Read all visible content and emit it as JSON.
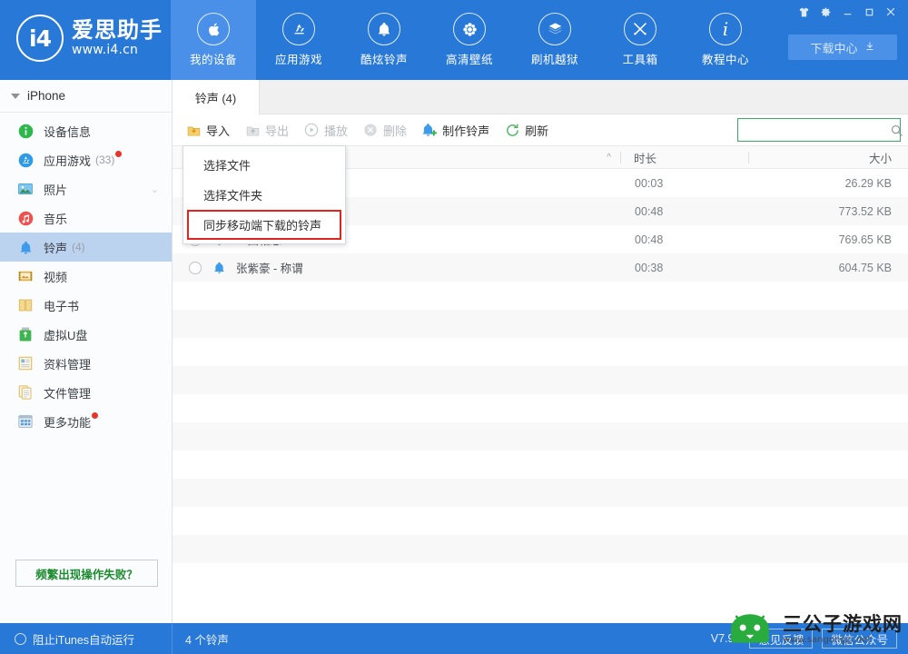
{
  "app": {
    "brand_name": "爱思助手",
    "brand_url": "www.i4.cn",
    "logo_mark": "i4",
    "accent_color": "#2878d8",
    "accent_active": "#4a90e8",
    "version": "V7.93"
  },
  "nav": [
    {
      "label": "我的设备",
      "icon": "apple-icon",
      "active": true
    },
    {
      "label": "应用游戏",
      "icon": "appstore-icon",
      "active": false
    },
    {
      "label": "酷炫铃声",
      "icon": "bell-icon",
      "active": false
    },
    {
      "label": "高清壁纸",
      "icon": "flower-icon",
      "active": false
    },
    {
      "label": "刷机越狱",
      "icon": "flash-box-icon",
      "active": false
    },
    {
      "label": "工具箱",
      "icon": "tools-icon",
      "active": false
    },
    {
      "label": "教程中心",
      "icon": "info-icon",
      "active": false
    }
  ],
  "window_controls": [
    {
      "name": "skin-icon",
      "glyph": "skin"
    },
    {
      "name": "settings-gear-icon",
      "glyph": "gear"
    },
    {
      "name": "minimize-icon",
      "glyph": "minimize"
    },
    {
      "name": "maximize-icon",
      "glyph": "maximize"
    },
    {
      "name": "close-icon",
      "glyph": "close"
    }
  ],
  "download_center": {
    "label": "下载中心",
    "icon": "download-icon"
  },
  "sidebar": {
    "device": {
      "name": "iPhone",
      "expanded": true
    },
    "items": [
      {
        "label": "设备信息",
        "icon": "info-circle-icon",
        "count": "",
        "badge": false,
        "active": false,
        "chevron": false
      },
      {
        "label": "应用游戏",
        "icon": "appstore-circle-icon",
        "count": "(33)",
        "badge": true,
        "active": false,
        "chevron": false
      },
      {
        "label": "照片",
        "icon": "photo-icon",
        "count": "",
        "badge": false,
        "active": false,
        "chevron": true
      },
      {
        "label": "音乐",
        "icon": "music-icon",
        "count": "",
        "badge": false,
        "active": false,
        "chevron": false
      },
      {
        "label": "铃声",
        "icon": "ringtone-bell-icon",
        "count": "(4)",
        "badge": false,
        "active": true,
        "chevron": false
      },
      {
        "label": "视频",
        "icon": "video-icon",
        "count": "",
        "badge": false,
        "active": false,
        "chevron": false
      },
      {
        "label": "电子书",
        "icon": "book-icon",
        "count": "",
        "badge": false,
        "active": false,
        "chevron": false
      },
      {
        "label": "虚拟U盘",
        "icon": "usb-icon",
        "count": "",
        "badge": false,
        "active": false,
        "chevron": false
      },
      {
        "label": "资料管理",
        "icon": "data-manage-icon",
        "count": "",
        "badge": false,
        "active": false,
        "chevron": false
      },
      {
        "label": "文件管理",
        "icon": "file-manage-icon",
        "count": "",
        "badge": false,
        "active": false,
        "chevron": false
      },
      {
        "label": "更多功能",
        "icon": "more-features-icon",
        "count": "",
        "badge": true,
        "active": false,
        "chevron": false
      }
    ],
    "help_button": "频繁出现操作失败？"
  },
  "tab": {
    "label": "铃声 (4)"
  },
  "toolbar": {
    "buttons": [
      {
        "label": "导入",
        "icon": "import-icon",
        "disabled": false
      },
      {
        "label": "导出",
        "icon": "export-icon",
        "disabled": true
      },
      {
        "label": "播放",
        "icon": "play-icon",
        "disabled": true
      },
      {
        "label": "删除",
        "icon": "delete-icon",
        "disabled": true
      },
      {
        "label": "制作铃声",
        "icon": "make-ringtone-icon",
        "disabled": false
      },
      {
        "label": "刷新",
        "icon": "refresh-icon",
        "disabled": false
      }
    ]
  },
  "search": {
    "value": "",
    "placeholder": "",
    "icon": "search-icon",
    "border_color": "#3fa76a"
  },
  "table": {
    "columns": [
      {
        "key": "name",
        "label": ""
      },
      {
        "key": "duration",
        "label": "时长"
      },
      {
        "key": "size",
        "label": "大小"
      }
    ],
    "sort_indicator": "^",
    "rows": [
      {
        "name": "",
        "duration": "00:03",
        "size": "26.29 KB",
        "checked": false
      },
      {
        "name": "",
        "duration": "00:48",
        "size": "773.52 KB",
        "checked": false
      },
      {
        "name": "一曲相思",
        "duration": "00:48",
        "size": "769.65 KB",
        "checked": false
      },
      {
        "name": "张紫豪 - 称谓",
        "duration": "00:38",
        "size": "604.75 KB",
        "checked": false
      }
    ],
    "empty_row_count": 10
  },
  "dropdown": {
    "items": [
      {
        "label": "选择文件",
        "highlighted": false
      },
      {
        "label": "选择文件夹",
        "highlighted": false
      },
      {
        "label": "同步移动端下载的铃声",
        "highlighted": true
      }
    ],
    "highlight_color": "#e5231d"
  },
  "statusbar": {
    "itunes_toggle": "阻止iTunes自动运行",
    "count_text": "4 个铃声",
    "version": "V7.93",
    "feedback_button": "意见反馈",
    "wechat_button": "微信公众号"
  },
  "watermark": {
    "title": "三公子游戏网",
    "url": "www.sangongzi.net",
    "mascot": "android-mascot-icon"
  }
}
